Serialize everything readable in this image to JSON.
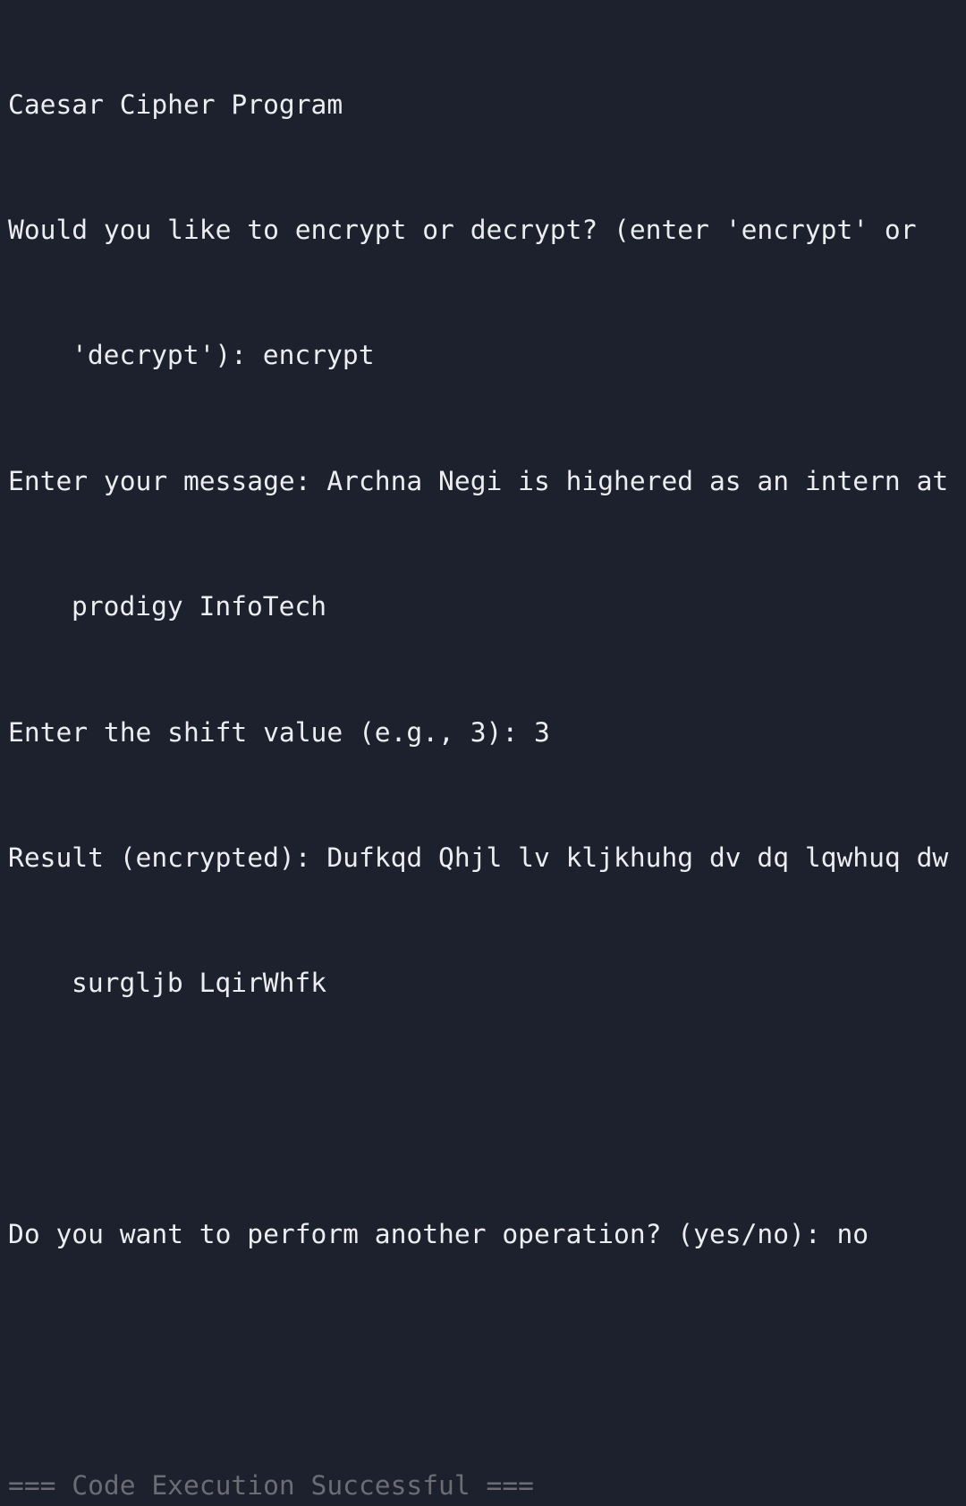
{
  "terminal": {
    "title": "Caesar Cipher Program",
    "mode_prompt_line1": "Would you like to encrypt or decrypt? (enter 'encrypt' or",
    "mode_prompt_line2": "'decrypt'): encrypt",
    "message_line1": "Enter your message: Archna Negi is highered as an intern at",
    "message_line2": "prodigy InfoTech",
    "shift_line": "Enter the shift value (e.g., 3): 3",
    "result_line1": "Result (encrypted): Dufkqd Qhjl lv kljkhuhg dv dq lqwhuq dw",
    "result_line2": "surgljb LqirWhfk",
    "again_line": "Do you want to perform another operation? (yes/no): no",
    "status_line": "=== Code Execution Successful ==="
  }
}
